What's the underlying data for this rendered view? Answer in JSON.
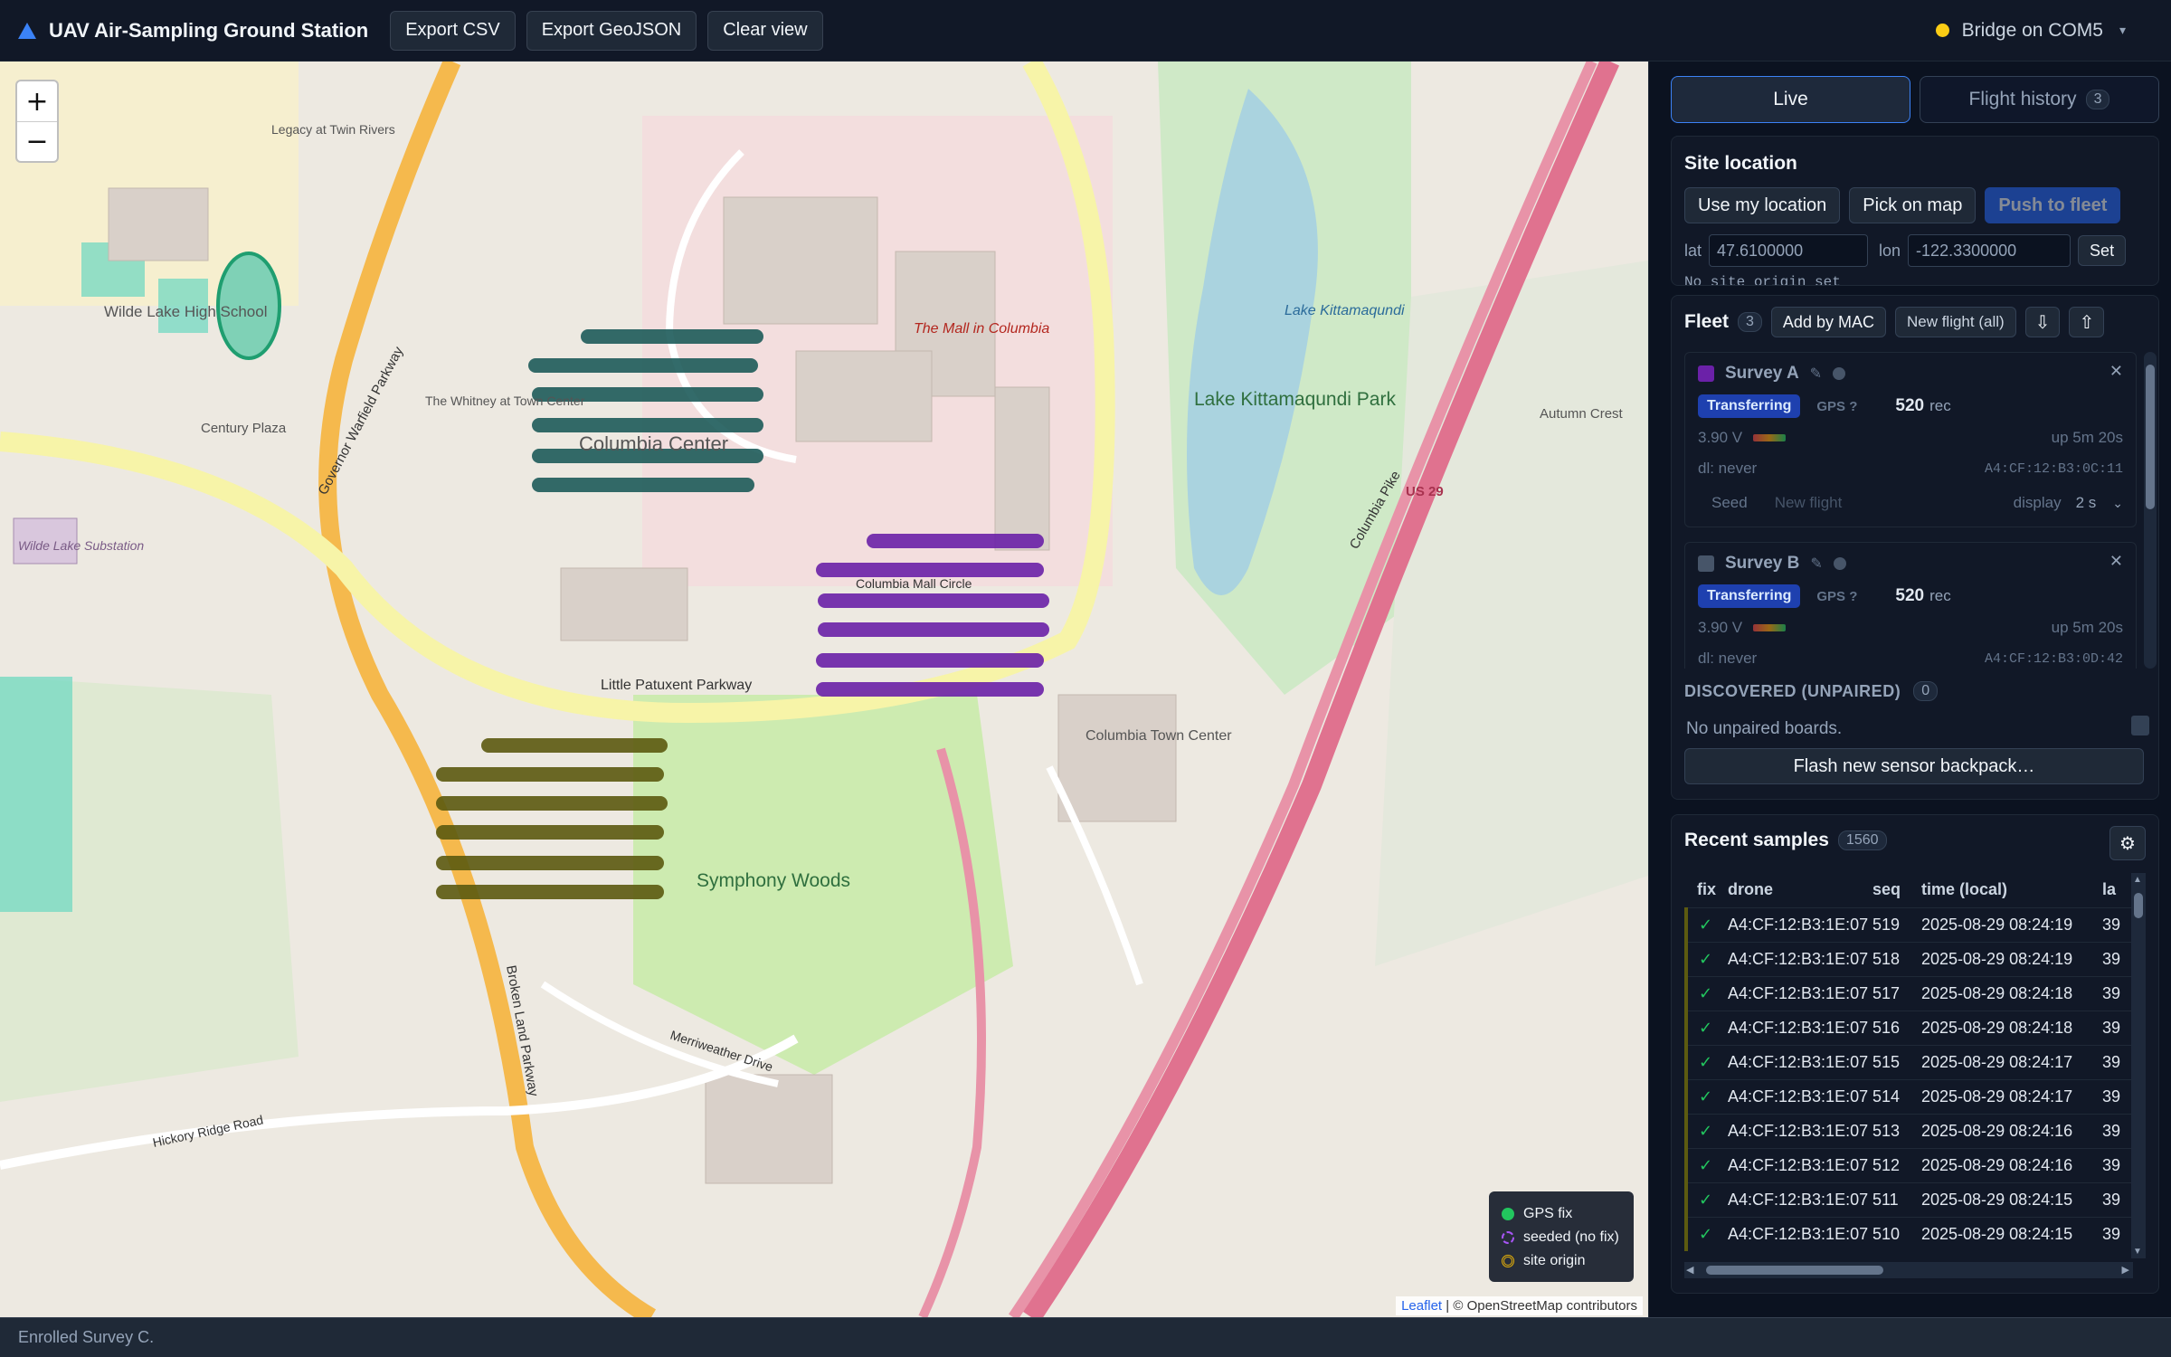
{
  "topbar": {
    "title": "UAV Air-Sampling Ground Station",
    "buttons": [
      "Export CSV",
      "Export GeoJSON",
      "Clear view"
    ],
    "bridge_label": "Bridge on COM5",
    "bridge_status_color": "#facc15"
  },
  "map": {
    "zoom_in": "+",
    "zoom_out": "−",
    "labels": {
      "wilde_lake_hs": "Wilde Lake High School",
      "columbia_center": "Columbia Center",
      "mall": "The Mall in Columbia",
      "lake_kitt_park": "Lake Kittamaqundi Park",
      "lake_kitt": "Lake Kittamaqundi",
      "symphony_woods": "Symphony Woods",
      "town_center": "Columbia Town Center",
      "century_plaza": "Century Plaza",
      "wilde_lake_sub": "Wilde Lake Substation",
      "whitney": "The Whitney at Town Center",
      "autumn_crest": "Autumn Crest",
      "legacy": "Legacy at Twin Rivers",
      "little_patuxent": "Little Patuxent Parkway",
      "broken_land": "Broken Land Parkway",
      "gov_warfield": "Governor Warfield Parkway",
      "columbia_pike": "Columbia Pike",
      "us29": "US 29",
      "columbia_mall_circle": "Columbia Mall Circle",
      "hickory_ridge": "Hickory Ridge Road",
      "merriweather": "Merriweather Drive"
    },
    "legend": {
      "gps_fix": "GPS fix",
      "seeded": "seeded (no fix)",
      "site_origin": "site origin"
    },
    "legend_colors": {
      "gps_fix": "#22c55e",
      "seeded": "#a855f7",
      "site_origin": "#eab308"
    },
    "attribution_link": "Leaflet",
    "attribution_text": "| © OpenStreetMap contributors",
    "track_colors": [
      "#1e5c5a",
      "#6b21a8",
      "#5c5a10"
    ]
  },
  "panel": {
    "tab_live": "Live",
    "tab_history": "Flight history",
    "history_count": "3",
    "site": {
      "title": "Site location",
      "use_location": "Use my location",
      "pick_on_map": "Pick on map",
      "push_to_fleet": "Push to fleet",
      "lat_label": "lat",
      "lat_value": "47.6100000",
      "lon_label": "lon",
      "lon_value": "-122.3300000",
      "set": "Set",
      "status": "No site origin set"
    },
    "fleet": {
      "title": "Fleet",
      "count": "3",
      "add_by_mac": "Add by MAC",
      "new_flight_all": "New flight (all)",
      "download_icon": "⇩",
      "upload_icon": "⇧",
      "drones": [
        {
          "name": "Survey A",
          "state": "Transferring",
          "gps": "GPS ?",
          "records": "520",
          "rec_unit": "rec",
          "voltage": "3.90 V",
          "uptime": "up 5m 20s",
          "dl": "dl: never",
          "mac": "A4:CF:12:B3:0C:11",
          "seed": "Seed",
          "new_flight": "New flight",
          "display_label": "display",
          "display_value": "2 s",
          "color": "#6b21a8"
        },
        {
          "name": "Survey B",
          "state": "Transferring",
          "gps": "GPS ?",
          "records": "520",
          "rec_unit": "rec",
          "voltage": "3.90 V",
          "uptime": "up 5m 20s",
          "dl": "dl: never",
          "mac": "A4:CF:12:B3:0D:42",
          "color": "#475569"
        }
      ],
      "discovered_title": "DISCOVERED (UNPAIRED)",
      "discovered_count": "0",
      "no_unpaired": "No unpaired boards.",
      "flash_button": "Flash new sensor backpack…"
    },
    "samples": {
      "title": "Recent samples",
      "count": "1560",
      "columns": [
        "fix",
        "drone",
        "seq",
        "time (local)",
        "la"
      ],
      "rows": [
        {
          "fix": "✓",
          "drone": "A4:CF:12:B3:1E:07",
          "seq": "519",
          "time": "2025-08-29 08:24:19",
          "lat": "39"
        },
        {
          "fix": "✓",
          "drone": "A4:CF:12:B3:1E:07",
          "seq": "518",
          "time": "2025-08-29 08:24:19",
          "lat": "39"
        },
        {
          "fix": "✓",
          "drone": "A4:CF:12:B3:1E:07",
          "seq": "517",
          "time": "2025-08-29 08:24:18",
          "lat": "39"
        },
        {
          "fix": "✓",
          "drone": "A4:CF:12:B3:1E:07",
          "seq": "516",
          "time": "2025-08-29 08:24:18",
          "lat": "39"
        },
        {
          "fix": "✓",
          "drone": "A4:CF:12:B3:1E:07",
          "seq": "515",
          "time": "2025-08-29 08:24:17",
          "lat": "39"
        },
        {
          "fix": "✓",
          "drone": "A4:CF:12:B3:1E:07",
          "seq": "514",
          "time": "2025-08-29 08:24:17",
          "lat": "39"
        },
        {
          "fix": "✓",
          "drone": "A4:CF:12:B3:1E:07",
          "seq": "513",
          "time": "2025-08-29 08:24:16",
          "lat": "39"
        },
        {
          "fix": "✓",
          "drone": "A4:CF:12:B3:1E:07",
          "seq": "512",
          "time": "2025-08-29 08:24:16",
          "lat": "39"
        },
        {
          "fix": "✓",
          "drone": "A4:CF:12:B3:1E:07",
          "seq": "511",
          "time": "2025-08-29 08:24:15",
          "lat": "39"
        },
        {
          "fix": "✓",
          "drone": "A4:CF:12:B3:1E:07",
          "seq": "510",
          "time": "2025-08-29 08:24:15",
          "lat": "39"
        }
      ]
    }
  },
  "status": "Enrolled Survey C."
}
